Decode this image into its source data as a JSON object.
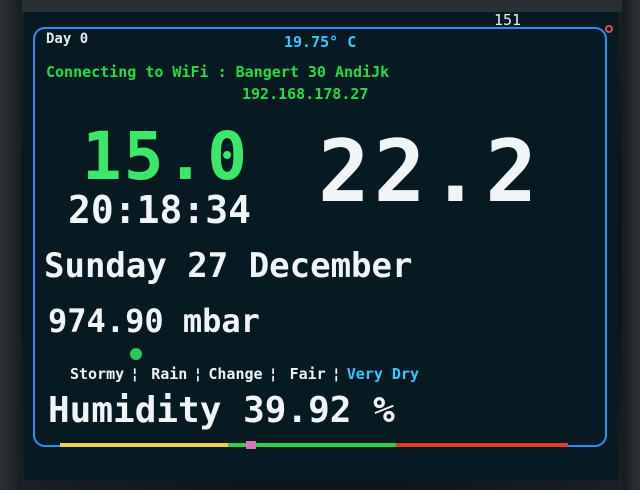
{
  "screen": {
    "corner_number": "151",
    "day_label": "Day 0",
    "indoor_temperature": "19.75° C",
    "wifi_status": "Connecting to WiFi : Bangert 30 AndiJk",
    "ip_address": "192.168.178.27",
    "big_left_value": "15.0",
    "big_right_value": "22.2",
    "time": "20:18:34",
    "date": "Sunday 27 December",
    "pressure": "974.90 mbar",
    "forecast_scale": {
      "stormy": "Stormy",
      "sep1": " ¦ ",
      "rain": "Rain",
      "sep2": " ¦ ",
      "change": "Change",
      "sep3": " ¦ ",
      "fair": "Fair",
      "sep4": " ¦ ",
      "very_dry": "Very Dry"
    },
    "humidity": "Humidity 39.92 %"
  },
  "colors": {
    "accent_green": "#3ae86a",
    "wifi_green": "#22dd44",
    "cyan": "#33c8ff",
    "panel_border": "#2f8cff",
    "bar_yellow": "#f2d14a",
    "bar_green": "#2fd24a",
    "bar_red": "#e0402a"
  }
}
